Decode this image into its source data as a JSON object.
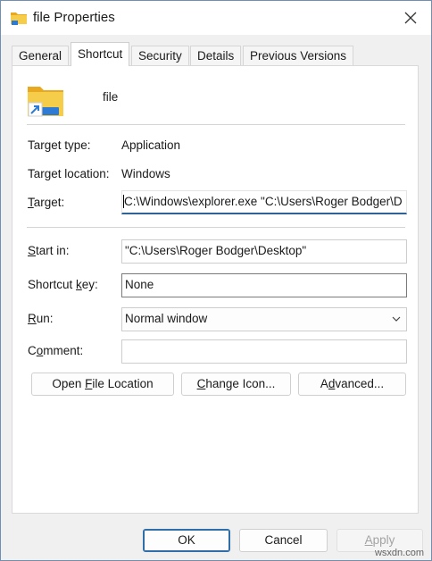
{
  "window": {
    "title": "file Properties"
  },
  "tabs": [
    {
      "label": "General"
    },
    {
      "label": "Shortcut"
    },
    {
      "label": "Security"
    },
    {
      "label": "Details"
    },
    {
      "label": "Previous Versions"
    }
  ],
  "active_tab": "Shortcut",
  "shortcut": {
    "name": "file",
    "target_type_label": "Target type:",
    "target_type_value": "Application",
    "target_location_label": "Target location:",
    "target_location_value": "Windows",
    "target_label_pre": "",
    "target_label_hotkey": "T",
    "target_label_post": "arget:",
    "target_value": "C:\\Windows\\explorer.exe \"C:\\Users\\Roger Bodger\\D",
    "start_in_label_pre": "",
    "start_in_label_hotkey": "S",
    "start_in_label_post": "tart in:",
    "start_in_value": "\"C:\\Users\\Roger Bodger\\Desktop\"",
    "shortcut_key_label_pre": "Shortcut ",
    "shortcut_key_label_hotkey": "k",
    "shortcut_key_label_post": "ey:",
    "shortcut_key_value": "None",
    "run_label_pre": "",
    "run_label_hotkey": "R",
    "run_label_post": "un:",
    "run_value": "Normal window",
    "comment_label_pre": "C",
    "comment_label_hotkey": "o",
    "comment_label_post": "mment:",
    "comment_value": ""
  },
  "actions": {
    "open_file_location_pre": "Open ",
    "open_file_location_hotkey": "F",
    "open_file_location_post": "ile Location",
    "change_icon_pre": "",
    "change_icon_hotkey": "C",
    "change_icon_post": "hange Icon...",
    "advanced_pre": "A",
    "advanced_hotkey": "d",
    "advanced_post": "vanced..."
  },
  "footer": {
    "ok_label": "OK",
    "cancel_label": "Cancel",
    "apply_label_pre": "",
    "apply_label_hotkey": "A",
    "apply_label_post": "pply"
  },
  "watermark": "wsxdn.com",
  "colors": {
    "focus_underline": "#2f6296",
    "folder_yellow": "#f3c641",
    "shortcut_arrow": "#2f7bd3"
  },
  "icons": {
    "title": "folder-icon",
    "close": "close-icon",
    "big": "folder-shortcut-icon",
    "dropdown": "chevron-down-icon"
  }
}
